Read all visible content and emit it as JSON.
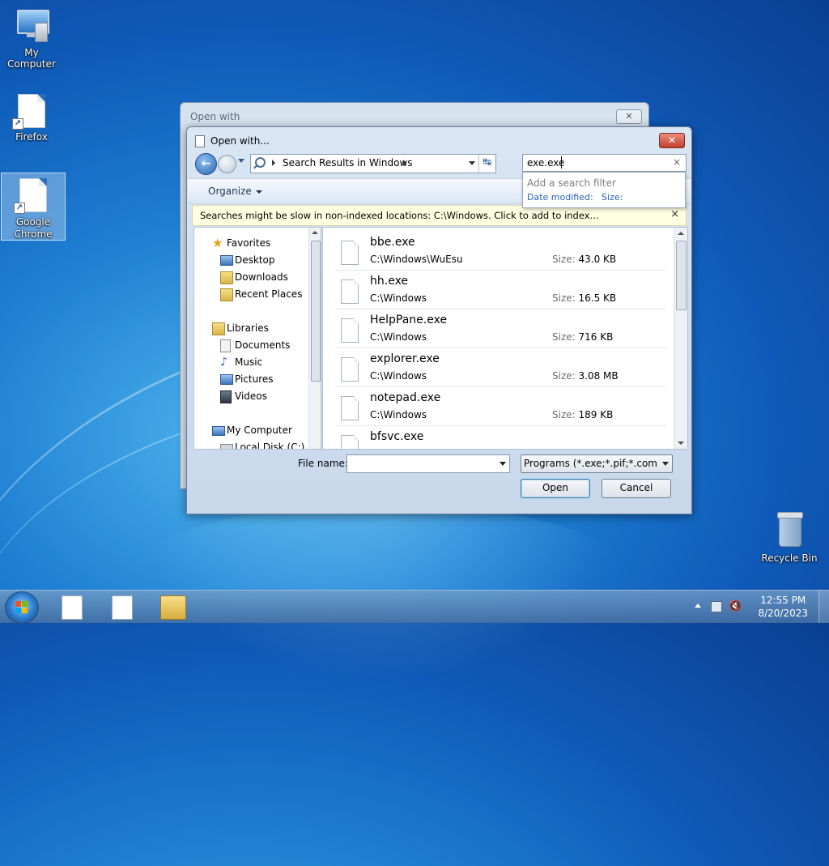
{
  "desktop": {
    "icons": [
      {
        "label": "My Computer",
        "icon": "computer-icon"
      },
      {
        "label": "Firefox",
        "icon": "document-shortcut-icon"
      },
      {
        "label": "Google Chrome",
        "icon": "document-shortcut-icon"
      },
      {
        "label": "Recycle Bin",
        "icon": "recycle-bin-icon"
      }
    ]
  },
  "bg_window": {
    "title": "Open with",
    "close": "✕"
  },
  "dialog": {
    "title": "Open with...",
    "close": "✕",
    "address": {
      "crumb": "Search Results in Windows"
    },
    "search": {
      "value": "exe.exe",
      "clear": "×"
    },
    "filter_popup": {
      "placeholder": "Add a search filter",
      "filter1": "Date modified:",
      "filter2": "Size:"
    },
    "toolbar": {
      "organize": "Organize"
    },
    "infobar": {
      "text": "Searches might be slow in non-indexed locations: C:\\Windows. Click to add to index...",
      "close": "×"
    },
    "nav": {
      "favorites": "Favorites",
      "desktop": "Desktop",
      "downloads": "Downloads",
      "recent": "Recent Places",
      "libraries": "Libraries",
      "documents": "Documents",
      "music": "Music",
      "pictures": "Pictures",
      "videos": "Videos",
      "computer": "My Computer",
      "localdisk": "Local Disk (C:)"
    },
    "size_label": "Size:",
    "files": [
      {
        "name": "bbe.exe",
        "path": "C:\\Windows\\WuEsu",
        "size": "43.0 KB"
      },
      {
        "name": "hh.exe",
        "path": "C:\\Windows",
        "size": "16.5 KB"
      },
      {
        "name": "HelpPane.exe",
        "path": "C:\\Windows",
        "size": "716 KB"
      },
      {
        "name": "explorer.exe",
        "path": "C:\\Windows",
        "size": "3.08 MB"
      },
      {
        "name": "notepad.exe",
        "path": "C:\\Windows",
        "size": "189 KB"
      },
      {
        "name": "bfsvc.exe",
        "path": "",
        "size": ""
      }
    ],
    "filename_label": "File name:",
    "filename_value": "",
    "filetype": "Programs (*.exe;*.pif;*.com;*.bat;*.cmd)",
    "open_label": "Open",
    "cancel_label": "Cancel"
  },
  "taskbar": {
    "time": "12:55 PM",
    "date": "8/20/2023"
  }
}
